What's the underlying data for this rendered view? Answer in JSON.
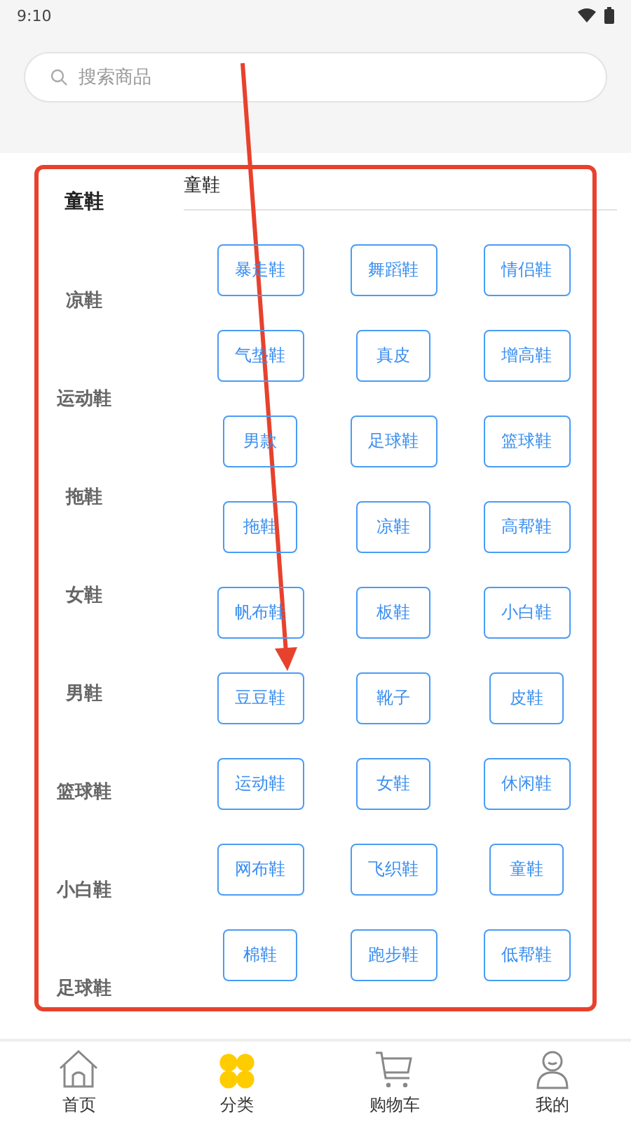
{
  "status_bar": {
    "time": "9:10"
  },
  "search": {
    "placeholder": "搜索商品"
  },
  "sidebar": {
    "items": [
      {
        "label": "童鞋",
        "selected": true
      },
      {
        "label": "凉鞋",
        "selected": false
      },
      {
        "label": "运动鞋",
        "selected": false
      },
      {
        "label": "拖鞋",
        "selected": false
      },
      {
        "label": "女鞋",
        "selected": false
      },
      {
        "label": "男鞋",
        "selected": false
      },
      {
        "label": "篮球鞋",
        "selected": false
      },
      {
        "label": "小白鞋",
        "selected": false
      },
      {
        "label": "足球鞋",
        "selected": false
      }
    ]
  },
  "category": {
    "title": "童鞋",
    "tags": [
      "暴走鞋",
      "舞蹈鞋",
      "情侣鞋",
      "气垫鞋",
      "真皮",
      "增高鞋",
      "男款",
      "足球鞋",
      "篮球鞋",
      "拖鞋",
      "凉鞋",
      "高帮鞋",
      "帆布鞋",
      "板鞋",
      "小白鞋",
      "豆豆鞋",
      "靴子",
      "皮鞋",
      "运动鞋",
      "女鞋",
      "休闲鞋",
      "网布鞋",
      "飞织鞋",
      "童鞋",
      "棉鞋",
      "跑步鞋",
      "低帮鞋"
    ]
  },
  "tab_bar": [
    {
      "label": "首页",
      "kind": "home",
      "selected": false
    },
    {
      "label": "分类",
      "kind": "category",
      "selected": true
    },
    {
      "label": "购物车",
      "kind": "cart",
      "selected": false
    },
    {
      "label": "我的",
      "kind": "profile",
      "selected": false
    }
  ]
}
